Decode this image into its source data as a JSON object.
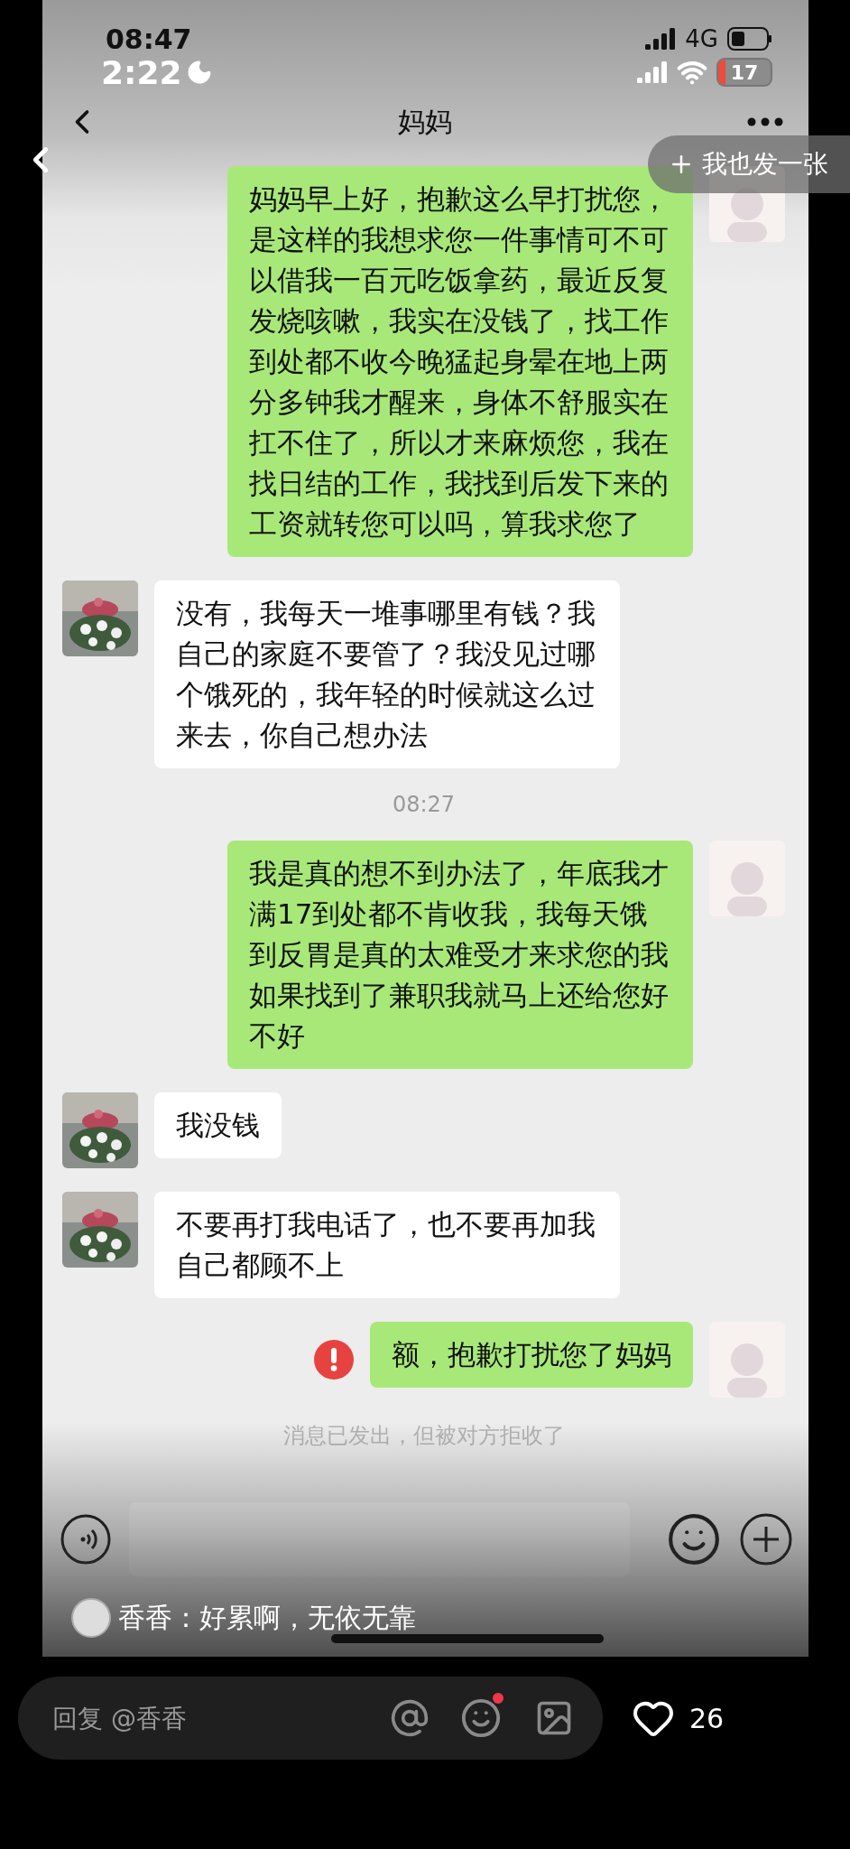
{
  "status_bars": [
    {
      "time": "08:47",
      "network": "4G"
    },
    {
      "time": "2:22",
      "battery": "17"
    }
  ],
  "chat_header": {
    "title": "妈妈"
  },
  "messages": [
    {
      "kind": "text",
      "outgoing": true,
      "failed": false,
      "text": "妈妈早上好，抱歉这么早打扰您，是这样的我想求您一件事情可不可以借我一百元吃饭拿药，最近反复发烧咳嗽，我实在没钱了，找工作到处都不收今晚猛起身晕在地上两分多钟我才醒来，身体不舒服实在扛不住了，所以才来麻烦您，我在找日结的工作，我找到后发下来的工资就转您可以吗，算我求您了"
    },
    {
      "kind": "text",
      "outgoing": false,
      "failed": false,
      "text": "没有，我每天一堆事哪里有钱？我自己的家庭不要管了？我没见过哪个饿死的，我年轻的时候就这么过来去，你自己想办法"
    },
    {
      "kind": "time",
      "text": "08:27"
    },
    {
      "kind": "text",
      "outgoing": true,
      "failed": false,
      "text": "我是真的想不到办法了，年底我才满17到处都不肯收我，我每天饿到反胃是真的太难受才来求您的我如果找到了兼职我就马上还给您好不好"
    },
    {
      "kind": "text",
      "outgoing": false,
      "failed": false,
      "text": "我没钱"
    },
    {
      "kind": "text",
      "outgoing": false,
      "failed": false,
      "text": "不要再打我电话了，也不要再加我自己都顾不上"
    },
    {
      "kind": "text",
      "outgoing": true,
      "failed": true,
      "text": "额，抱歉打扰您了妈妈"
    },
    {
      "kind": "notice",
      "text": "消息已发出，但被对方拒收了"
    }
  ],
  "post_button": {
    "label": "我也发一张"
  },
  "comment": {
    "text": "香香：好累啊，无依无靠"
  },
  "reply_bar": {
    "placeholder": "回复 @香香",
    "emoji_unread": true
  },
  "likes": "26"
}
